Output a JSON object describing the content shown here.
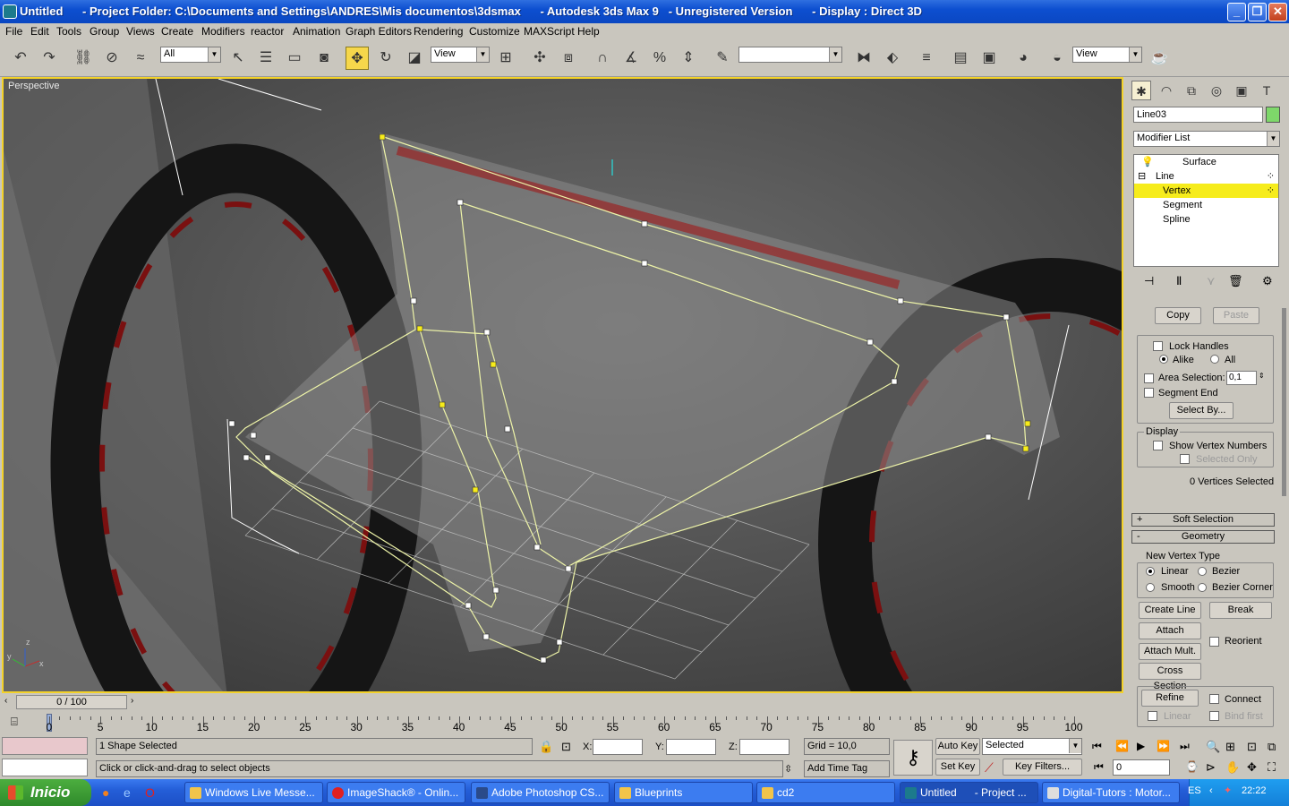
{
  "window": {
    "title": "Untitled      - Project Folder: C:\\Documents and Settings\\ANDRES\\Mis documentos\\3dsmax      - Autodesk 3ds Max 9   - Unregistered Version      - Display : Direct 3D",
    "minimize_icon": "minimize-icon",
    "restore_icon": "restore-icon",
    "close_icon": "close-icon"
  },
  "menu": [
    "File",
    "Edit",
    "Tools",
    "Group",
    "Views",
    "Create",
    "Modifiers",
    "reactor",
    "Animation",
    "Graph Editors",
    "Rendering",
    "Customize",
    "MAXScript",
    "Help"
  ],
  "toolbar": {
    "selection_filter": "All",
    "ref_coord": "View",
    "named_selection": "",
    "render_type": "View"
  },
  "viewport": {
    "label": "Perspective",
    "axis_labels": [
      "x",
      "y",
      "z"
    ]
  },
  "command_panel": {
    "object_name": "Line03",
    "object_color": "#7ed86a",
    "modifier_list": "Modifier List",
    "stack": [
      {
        "label": "Surface",
        "icon": "bulb-icon"
      },
      {
        "label": "Line",
        "icon": "minus-box-icon"
      },
      {
        "label": "Vertex",
        "selected": true
      },
      {
        "label": "Segment"
      },
      {
        "label": "Spline"
      }
    ],
    "selection": {
      "copy": "Copy",
      "paste": "Paste",
      "lock_handles": "Lock Handles",
      "alike": "Alike",
      "all": "All",
      "area_selection": "Area Selection:",
      "area_value": "0,1",
      "segment_end": "Segment End",
      "select_by": "Select By...",
      "display": "Display",
      "show_vertex_numbers": "Show Vertex Numbers",
      "selected_only": "Selected Only",
      "vertices_selected": "0 Vertices Selected"
    },
    "soft_selection": {
      "sign": "+",
      "label": "Soft Selection"
    },
    "geometry": {
      "sign": "-",
      "label": "Geometry",
      "new_vertex_type": "New Vertex Type",
      "linear": "Linear",
      "bezier": "Bezier",
      "smooth": "Smooth",
      "bezier_corner": "Bezier Corner",
      "create_line": "Create Line",
      "break": "Break",
      "attach": "Attach",
      "attach_mult": "Attach Mult.",
      "reorient": "Reorient",
      "cross_section": "Cross Section",
      "refine": "Refine",
      "connect": "Connect",
      "linear2": "Linear",
      "bind_first": "Bind first"
    }
  },
  "timeline": {
    "frame": "0 / 100",
    "ticks": [
      "0",
      "5",
      "10",
      "15",
      "20",
      "25",
      "30",
      "35",
      "40",
      "45",
      "50",
      "55",
      "60",
      "65",
      "70",
      "75",
      "80",
      "85",
      "90",
      "95",
      "100"
    ]
  },
  "status": {
    "selected": "1 Shape Selected",
    "prompt": "Click or click-and-drag to select objects",
    "x_label": "X:",
    "y_label": "Y:",
    "z_label": "Z:",
    "grid": "Grid = 10,0",
    "add_time_tag": "Add Time Tag",
    "auto_key": "Auto Key",
    "set_key": "Set Key",
    "key_mode": "Selected",
    "key_filters": "Key Filters...",
    "current_frame": "0"
  },
  "taskbar": {
    "start": "Inicio",
    "tasks": [
      "Windows Live Messe...",
      "ImageShack® - Onlin...",
      "Adobe Photoshop CS...",
      "Blueprints",
      "cd2",
      "Untitled      - Project ...",
      "Digital-Tutors : Motor..."
    ],
    "language": "ES",
    "clock": "22:22"
  }
}
